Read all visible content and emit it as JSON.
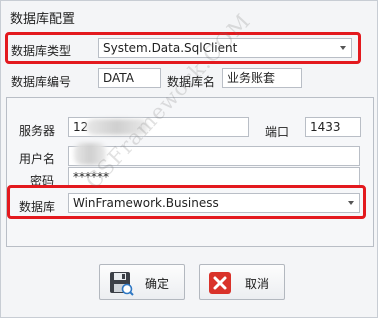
{
  "dialog": {
    "title": "数据库配置"
  },
  "db_type": {
    "label": "数据库类型",
    "value": "System.Data.SqlClient"
  },
  "db_number": {
    "label": "数据库编号",
    "value": "DATA"
  },
  "db_name": {
    "label": "数据库名",
    "value": "业务账套"
  },
  "server": {
    "label": "服务器",
    "value": "12",
    "port_label": "端口",
    "port_value": "1433"
  },
  "user": {
    "label": "用户名",
    "value": ""
  },
  "password": {
    "label": "密码",
    "value": "******"
  },
  "database": {
    "label": "数据库",
    "value": "WinFramework.Business"
  },
  "buttons": {
    "ok": "确定",
    "cancel": "取消"
  },
  "watermark": "CSFramework.COM",
  "colors": {
    "highlight": "#e3191e",
    "border": "#b9bec6"
  }
}
